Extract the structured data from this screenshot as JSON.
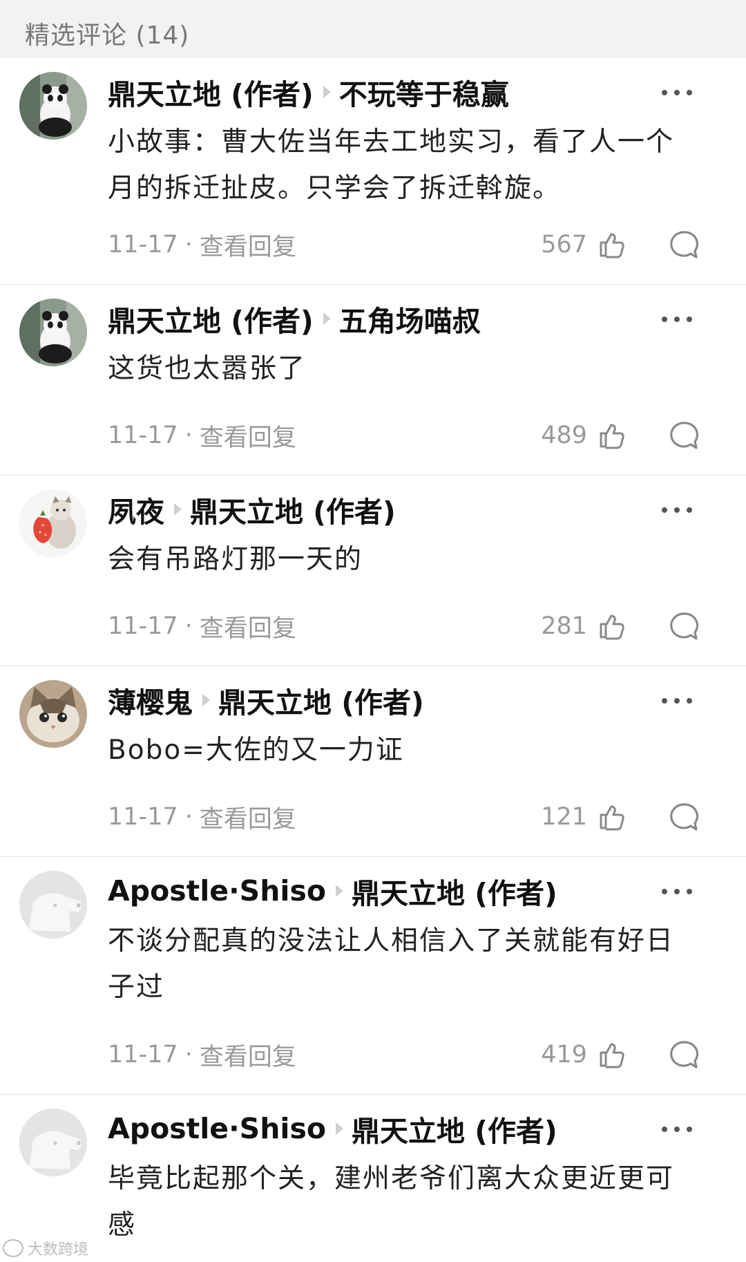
{
  "header": {
    "title": "精选评论 (14)"
  },
  "comments": [
    {
      "author": "鼎天立地 (作者)",
      "reply_to": "不玩等于稳赢",
      "text": "小故事：曹大佐当年去工地实习，看了人一个月的拆迁扯皮。只学会了拆迁斡旋。",
      "date": "11-17",
      "view_replies": "查看回复",
      "likes": "567",
      "avatar": "panda-avatar"
    },
    {
      "author": "鼎天立地 (作者)",
      "reply_to": "五角场喵叔",
      "text": "这货也太嚣张了",
      "date": "11-17",
      "view_replies": "查看回复",
      "likes": "489",
      "avatar": "panda-avatar"
    },
    {
      "author": "夙夜",
      "reply_to": "鼎天立地 (作者)",
      "text": "会有吊路灯那一天的",
      "date": "11-17",
      "view_replies": "查看回复",
      "likes": "281",
      "avatar": "cat-strawberry-avatar"
    },
    {
      "author": "薄樱鬼",
      "reply_to": "鼎天立地 (作者)",
      "text": "Bobo=大佐的又一力证",
      "date": "11-17",
      "view_replies": "查看回复",
      "likes": "121",
      "avatar": "cat-face-avatar"
    },
    {
      "author": "Apostle·Shiso",
      "reply_to": "鼎天立地 (作者)",
      "text": "不谈分配真的没法让人相信入了关就能有好日子过",
      "date": "11-17",
      "view_replies": "查看回复",
      "likes": "419",
      "avatar": "default-avatar"
    },
    {
      "author": "Apostle·Shiso",
      "reply_to": "鼎天立地 (作者)",
      "text": "毕竟比起那个关，建州老爷们离大众更近更可感",
      "avatar": "default-avatar"
    }
  ],
  "watermark": "大数跨境",
  "colors": {
    "header_bg": "#f2f2f2",
    "meta_text": "#999999",
    "divider": "#e3e3e3"
  }
}
